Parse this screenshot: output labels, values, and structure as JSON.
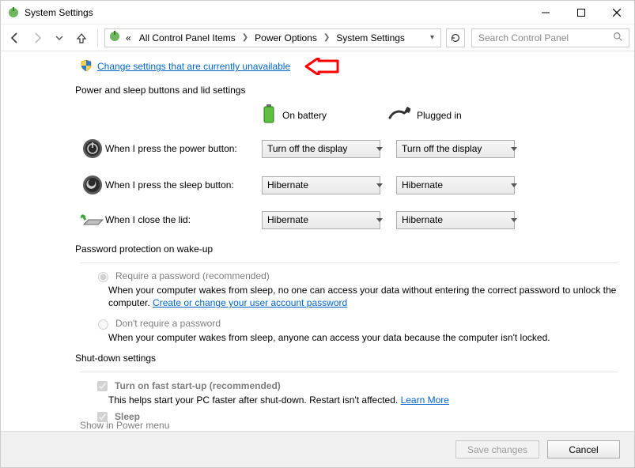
{
  "window": {
    "title": "System Settings"
  },
  "nav": {
    "breadcrumb_prefix": "«",
    "crumbs": [
      "All Control Panel Items",
      "Power Options",
      "System Settings"
    ],
    "search_placeholder": "Search Control Panel"
  },
  "admin_link": "Change settings that are currently unavailable",
  "sections": {
    "buttons_lid": {
      "heading": "Power and sleep buttons and lid settings",
      "col_battery": "On battery",
      "col_plugged": "Plugged in",
      "rows": [
        {
          "label": "When I press the power button:",
          "battery": "Turn off the display",
          "plugged": "Turn off the display"
        },
        {
          "label": "When I press the sleep button:",
          "battery": "Hibernate",
          "plugged": "Hibernate"
        },
        {
          "label": "When I close the lid:",
          "battery": "Hibernate",
          "plugged": "Hibernate"
        }
      ]
    },
    "password": {
      "heading": "Password protection on wake-up",
      "require": {
        "label": "Require a password (recommended)",
        "desc_a": "When your computer wakes from sleep, no one can access your data without entering the correct password to unlock the computer. ",
        "link": "Create or change your user account password"
      },
      "norequire": {
        "label": "Don't require a password",
        "desc": "When your computer wakes from sleep, anyone can access your data because the computer isn't locked."
      }
    },
    "shutdown": {
      "heading": "Shut-down settings",
      "fast": {
        "label": "Turn on fast start-up (recommended)",
        "desc": "This helps start your PC faster after shut-down. Restart isn't affected. ",
        "link": "Learn More"
      },
      "sleep": {
        "label": "Sleep"
      },
      "partial": "Show in Power menu"
    }
  },
  "footer": {
    "save": "Save changes",
    "cancel": "Cancel"
  }
}
